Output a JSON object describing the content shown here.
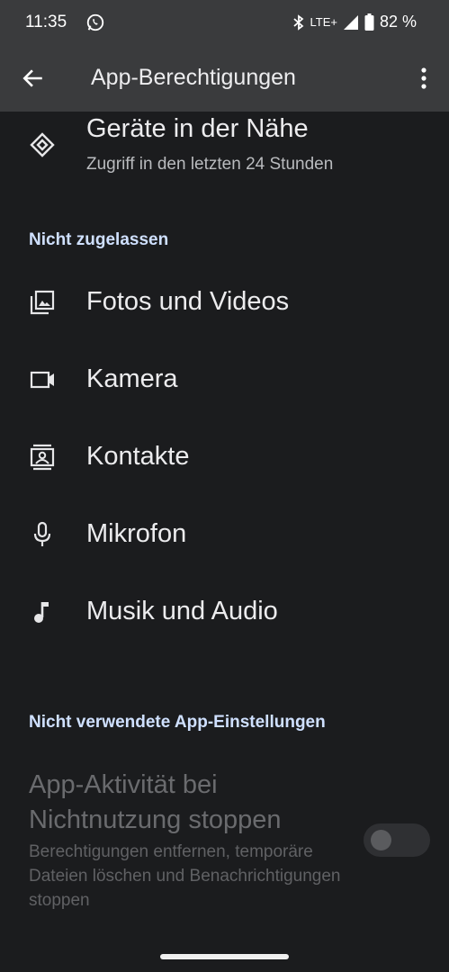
{
  "status_bar": {
    "time": "11:35",
    "network": "LTE+",
    "battery": "82 %",
    "icons": [
      "whatsapp-icon",
      "bluetooth-icon",
      "signal-icon",
      "battery-icon"
    ]
  },
  "app_bar": {
    "title": "App-Berechtigungen",
    "icons": [
      "back-arrow-icon",
      "more-vert-icon"
    ]
  },
  "top_item": {
    "label": "Geräte in der Nähe",
    "sub": "Zugriff in den letzten 24 Stunden",
    "icon": "nearby-devices-icon"
  },
  "section_not_allowed": {
    "header": "Nicht zugelassen",
    "items": [
      {
        "label": "Fotos und Videos",
        "icon": "photos-icon"
      },
      {
        "label": "Kamera",
        "icon": "camera-icon"
      },
      {
        "label": "Kontakte",
        "icon": "contacts-icon"
      },
      {
        "label": "Mikrofon",
        "icon": "microphone-icon"
      },
      {
        "label": "Musik und Audio",
        "icon": "music-note-icon"
      }
    ]
  },
  "section_unused": {
    "header": "Nicht verwendete App-Einstellungen",
    "setting_title": "App-Aktivität bei Nichtnutzung stoppen",
    "setting_sub": "Berechtigungen entfernen, temporäre Dateien löschen und Benachrichtigungen stoppen",
    "toggle_on": false
  },
  "colors": {
    "background": "#1b1c1e",
    "app_bar": "#3a3b3d",
    "section_header": "#cfe0ff",
    "disabled_text": "#6a6b6e"
  }
}
